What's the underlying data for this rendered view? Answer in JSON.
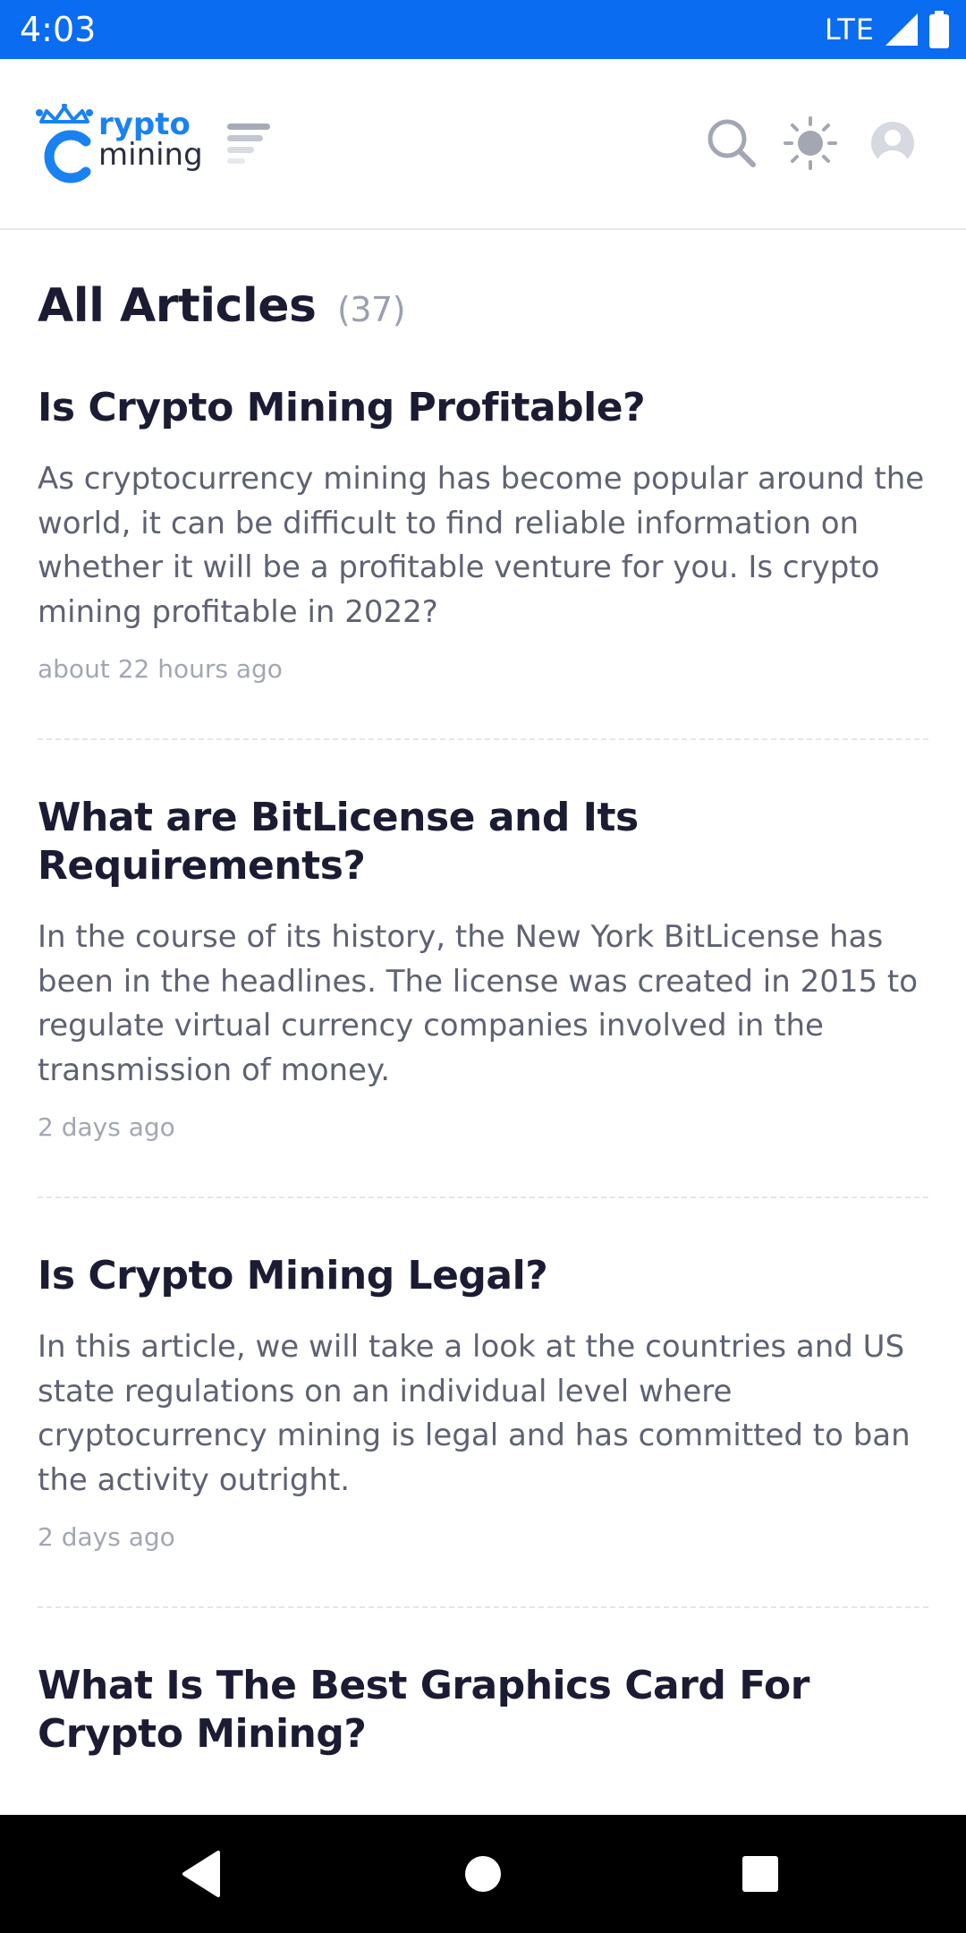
{
  "status_bar": {
    "time": "4:03",
    "network": "LTE"
  },
  "header": {
    "logo": {
      "line1": "rypto",
      "line2": "mining"
    },
    "icons": {
      "menu": "menu-icon",
      "search": "search-icon",
      "theme": "sun-icon",
      "avatar": "user-avatar-icon"
    }
  },
  "page": {
    "title": "All Articles",
    "count": "(37)"
  },
  "articles": [
    {
      "title": "Is Crypto Mining Profitable?",
      "excerpt": "As cryptocurrency mining has become popular around the world, it can be difficult to find reliable information on whether it will be a profitable venture for you. Is crypto mining profitable in 2022?",
      "time": "about 22 hours ago"
    },
    {
      "title": "What are BitLicense and Its Requirements?",
      "excerpt": "In the course of its history, the New York BitLicense has been in the headlines. The license was created in 2015 to regulate virtual currency companies involved in the transmission of money.",
      "time": "2 days ago"
    },
    {
      "title": "Is Crypto Mining Legal?",
      "excerpt": "In this article, we will take a look at the countries and US state regulations on an individual level where cryptocurrency mining is legal and has committed to ban the activity outright.",
      "time": "2 days ago"
    },
    {
      "title": "What Is The Best Graphics Card For Crypto Mining?"
    }
  ],
  "colors": {
    "status_bar": "#0a6cf0",
    "brand_blue": "#1a82f0",
    "heading": "#1b1c33",
    "body_text": "#5e6272",
    "muted": "#a2a7b3"
  }
}
